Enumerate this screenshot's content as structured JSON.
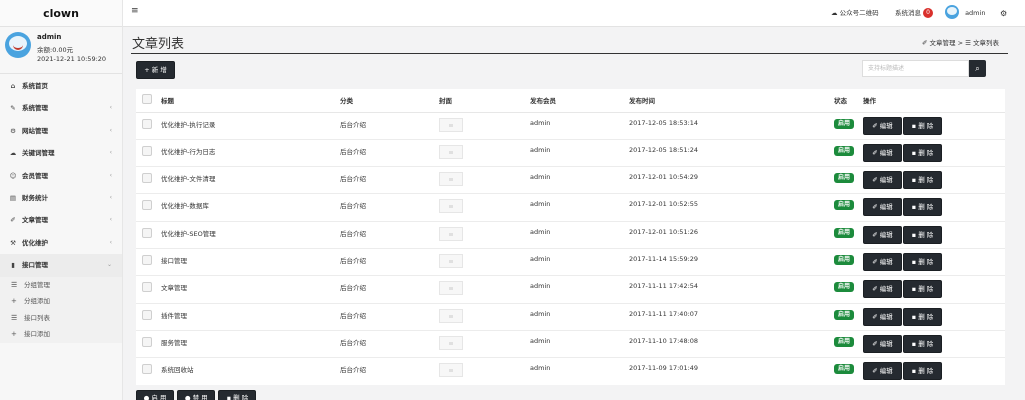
{
  "app": {
    "logo": "clown"
  },
  "profile": {
    "name": "admin",
    "balance": "余额:0.00元",
    "time": "2021-12-21 10:59:20"
  },
  "sidebar": {
    "items": [
      {
        "label": "系统首页",
        "icon": "home-icon",
        "glyph": "⌂",
        "expand": false
      },
      {
        "label": "系统管理",
        "icon": "wrench-icon",
        "glyph": "✎",
        "expand": true
      },
      {
        "label": "网站管理",
        "icon": "gear-icon",
        "glyph": "⚙",
        "expand": true
      },
      {
        "label": "关键词管理",
        "icon": "cloud-icon",
        "glyph": "☁",
        "expand": true
      },
      {
        "label": "会员管理",
        "icon": "users-icon",
        "glyph": "☺",
        "expand": true
      },
      {
        "label": "财务统计",
        "icon": "chart-icon",
        "glyph": "▤",
        "expand": true
      },
      {
        "label": "文章管理",
        "icon": "edit-icon",
        "glyph": "✐",
        "expand": true
      },
      {
        "label": "优化维护",
        "icon": "hammer-icon",
        "glyph": "⚒",
        "expand": true
      },
      {
        "label": "接口管理",
        "icon": "book-icon",
        "glyph": "▮",
        "expand": true
      }
    ],
    "subitems": [
      {
        "label": "分组管理",
        "icon": "list-icon",
        "glyph": "☰"
      },
      {
        "label": "分组添加",
        "icon": "plus-icon",
        "glyph": "+"
      },
      {
        "label": "接口列表",
        "icon": "list-icon",
        "glyph": "☰"
      },
      {
        "label": "接口添加",
        "icon": "plus-icon",
        "glyph": "+"
      }
    ]
  },
  "topbar": {
    "wechat": "公众号二维码",
    "messages": "系统消息",
    "message_count": "0",
    "user": "admin"
  },
  "page": {
    "title": "文章列表",
    "breadcrumb_parent": "文章管理",
    "breadcrumb_sep": ">",
    "breadcrumb_current": "文章列表"
  },
  "toolbar": {
    "add_label": "新 增",
    "search_placeholder": "支持标题描述"
  },
  "table": {
    "headers": {
      "title": "标题",
      "category": "分类",
      "cover": "封面",
      "author": "发布会员",
      "time": "发布时间",
      "status": "状态",
      "ops": "操作"
    },
    "edit_label": "编辑",
    "delete_label": "删 除",
    "rows": [
      {
        "title": "优化维护-执行记录",
        "category": "后台介绍",
        "author": "admin",
        "time": "2017-12-05 18:53:14",
        "status": "启用"
      },
      {
        "title": "优化维护-行为日志",
        "category": "后台介绍",
        "author": "admin",
        "time": "2017-12-05 18:51:24",
        "status": "启用"
      },
      {
        "title": "优化维护-文件清理",
        "category": "后台介绍",
        "author": "admin",
        "time": "2017-12-01 10:54:29",
        "status": "启用"
      },
      {
        "title": "优化维护-数据库",
        "category": "后台介绍",
        "author": "admin",
        "time": "2017-12-01 10:52:55",
        "status": "启用"
      },
      {
        "title": "优化维护-SEO管理",
        "category": "后台介绍",
        "author": "admin",
        "time": "2017-12-01 10:51:26",
        "status": "启用"
      },
      {
        "title": "接口管理",
        "category": "后台介绍",
        "author": "admin",
        "time": "2017-11-14 15:59:29",
        "status": "启用"
      },
      {
        "title": "文章管理",
        "category": "后台介绍",
        "author": "admin",
        "time": "2017-11-11 17:42:54",
        "status": "启用"
      },
      {
        "title": "插件管理",
        "category": "后台介绍",
        "author": "admin",
        "time": "2017-11-11 17:40:07",
        "status": "启用"
      },
      {
        "title": "服务管理",
        "category": "后台介绍",
        "author": "admin",
        "time": "2017-11-10 17:48:08",
        "status": "启用"
      },
      {
        "title": "系统回收站",
        "category": "后台介绍",
        "author": "admin",
        "time": "2017-11-09 17:01:49",
        "status": "启用"
      }
    ]
  },
  "bulk": {
    "enable_label": "启 用",
    "disable_label": "禁 用",
    "delete_label": "删 除"
  }
}
